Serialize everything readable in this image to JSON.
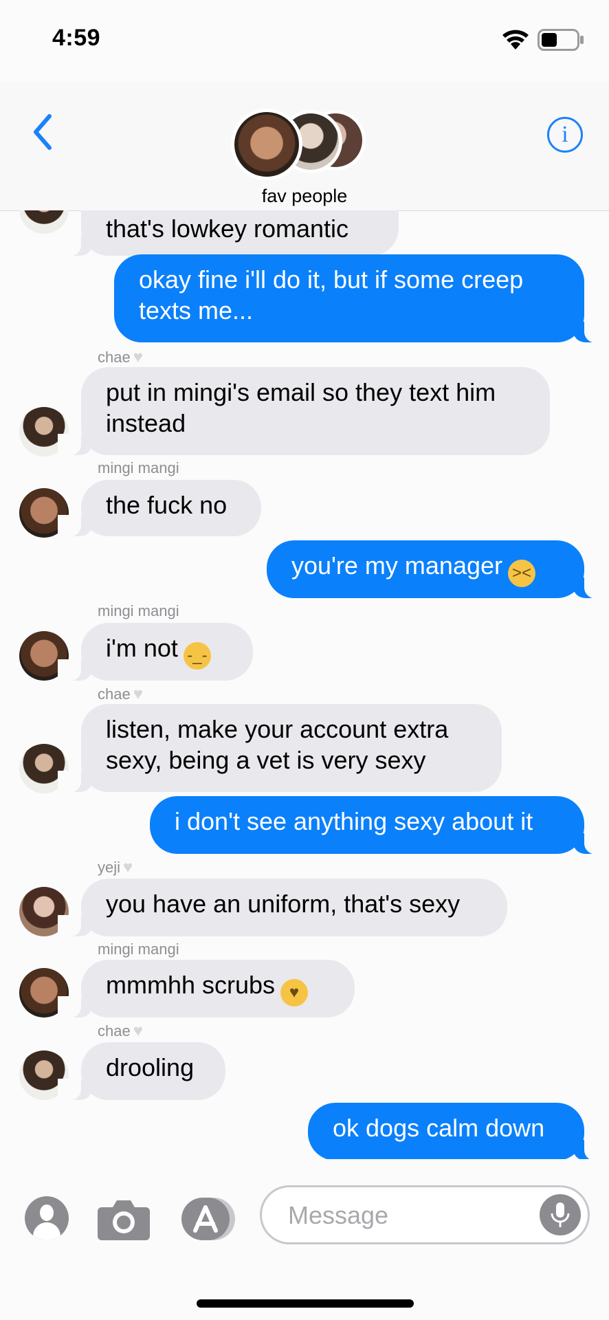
{
  "status": {
    "time": "4:59"
  },
  "header": {
    "group_name": "fav people"
  },
  "messages": {
    "m0": {
      "text": "that's lowkey romantic"
    },
    "m1": {
      "text": "okay fine i'll do it, but if some creep texts me..."
    },
    "m2": {
      "sender": "chae",
      "text": "put in mingi's email so they text him instead"
    },
    "m3": {
      "sender": "mingi mangi",
      "text": "the fuck no"
    },
    "m4": {
      "text": "you're my manager",
      "emoji": "tired-face"
    },
    "m5": {
      "sender": "mingi mangi",
      "text": "i'm not",
      "emoji": "raised-eyebrow"
    },
    "m6": {
      "sender": "chae",
      "text": "listen, make your account extra sexy, being a vet is very sexy"
    },
    "m7": {
      "text": "i don't see anything sexy about it"
    },
    "m8": {
      "sender": "yeji",
      "text": "you have an uniform, that's sexy"
    },
    "m9": {
      "sender": "mingi mangi",
      "text": "mmmhh scrubs",
      "emoji": "smiling-face-with-hearts"
    },
    "m10": {
      "sender": "chae",
      "text": "drooling"
    },
    "m11": {
      "text": "ok dogs calm down"
    }
  },
  "composer": {
    "placeholder": "Message"
  },
  "colors": {
    "accent": "#0b80fb",
    "incoming": "#e9e8ed"
  }
}
